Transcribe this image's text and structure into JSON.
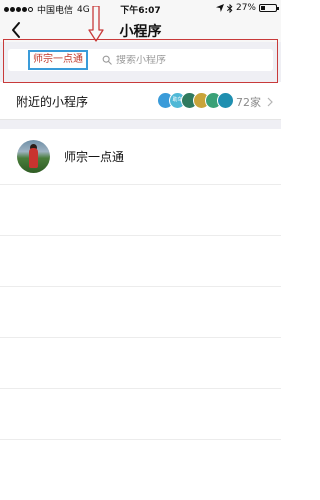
{
  "status_bar": {
    "carrier": "中国电信",
    "network": "4G",
    "time": "下午6:07",
    "battery_percent": "27%",
    "battery_level": 0.27
  },
  "nav": {
    "title": "小程序",
    "back_icon": "chevron-left-icon"
  },
  "search": {
    "tag_label": "师宗一点通",
    "placeholder": "搜索小程序",
    "icon": "search-icon"
  },
  "nearby": {
    "label": "附近的小程序",
    "count": "72家",
    "avatars": [
      {
        "color": "#3a9bd9"
      },
      {
        "color": "#4fb8d6",
        "text": "助车"
      },
      {
        "color": "#2f7a5f"
      },
      {
        "color": "#c9a43a"
      },
      {
        "color": "#3aa177"
      },
      {
        "color": "#1f8fb0"
      }
    ]
  },
  "programs": [
    {
      "name": "师宗一点通"
    }
  ],
  "colors": {
    "annotation": "#c83a3a",
    "tag_border": "#3a9bd9",
    "tag_text": "#c0392b",
    "page_bg": "#efeff4"
  }
}
